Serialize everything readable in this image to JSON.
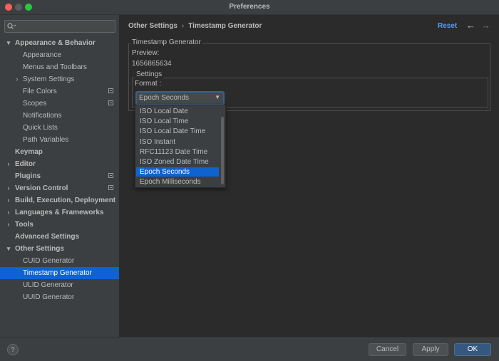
{
  "window": {
    "title": "Preferences"
  },
  "sidebar": {
    "search_placeholder": "",
    "items": [
      {
        "label": "Appearance & Behavior",
        "bold": true,
        "chevron": "▾",
        "level": 0
      },
      {
        "label": "Appearance",
        "bold": false,
        "level": 1
      },
      {
        "label": "Menus and Toolbars",
        "bold": false,
        "level": 1
      },
      {
        "label": "System Settings",
        "bold": false,
        "chevron": "›",
        "level": 1
      },
      {
        "label": "File Colors",
        "bold": false,
        "level": 1,
        "project_icon": true
      },
      {
        "label": "Scopes",
        "bold": false,
        "level": 1,
        "project_icon": true
      },
      {
        "label": "Notifications",
        "bold": false,
        "level": 1
      },
      {
        "label": "Quick Lists",
        "bold": false,
        "level": 1
      },
      {
        "label": "Path Variables",
        "bold": false,
        "level": 1
      },
      {
        "label": "Keymap",
        "bold": true,
        "level": 0
      },
      {
        "label": "Editor",
        "bold": true,
        "chevron": "›",
        "level": 0
      },
      {
        "label": "Plugins",
        "bold": true,
        "level": 0,
        "project_icon": true
      },
      {
        "label": "Version Control",
        "bold": true,
        "chevron": "›",
        "level": 0,
        "project_icon": true
      },
      {
        "label": "Build, Execution, Deployment",
        "bold": true,
        "chevron": "›",
        "level": 0
      },
      {
        "label": "Languages & Frameworks",
        "bold": true,
        "chevron": "›",
        "level": 0
      },
      {
        "label": "Tools",
        "bold": true,
        "chevron": "›",
        "level": 0
      },
      {
        "label": "Advanced Settings",
        "bold": true,
        "level": 0
      },
      {
        "label": "Other Settings",
        "bold": true,
        "chevron": "▾",
        "level": 0
      },
      {
        "label": "CUID Generator",
        "bold": false,
        "level": 1
      },
      {
        "label": "Timestamp Generator",
        "bold": false,
        "level": 1,
        "selected": true
      },
      {
        "label": "ULID Generator",
        "bold": false,
        "level": 1
      },
      {
        "label": "UUID Generator",
        "bold": false,
        "level": 1
      }
    ]
  },
  "header": {
    "breadcrumb_parent": "Other Settings",
    "breadcrumb_separator": "›",
    "breadcrumb_current": "Timestamp Generator",
    "reset_label": "Reset",
    "back_glyph": "←",
    "forward_glyph": "→"
  },
  "panel": {
    "group_title": "Timestamp Generator",
    "preview_label": "Preview:",
    "preview_value": "1656865634",
    "settings_title": "Settings",
    "format_label": "Format :",
    "format_selected": "Epoch Seconds",
    "format_options": [
      "ISO Local Date",
      "ISO Local Time",
      "ISO Local Date Time",
      "ISO Instant",
      "RFC11123 Date Time",
      "ISO Zoned Date Time",
      "Epoch Seconds",
      "Epoch Milliseconds"
    ],
    "selected_index": 6
  },
  "footer": {
    "help_label": "?",
    "cancel_label": "Cancel",
    "apply_label": "Apply",
    "ok_label": "OK"
  },
  "colors": {
    "accent": "#0d63d1",
    "link": "#589df6",
    "ok_button": "#365880"
  }
}
